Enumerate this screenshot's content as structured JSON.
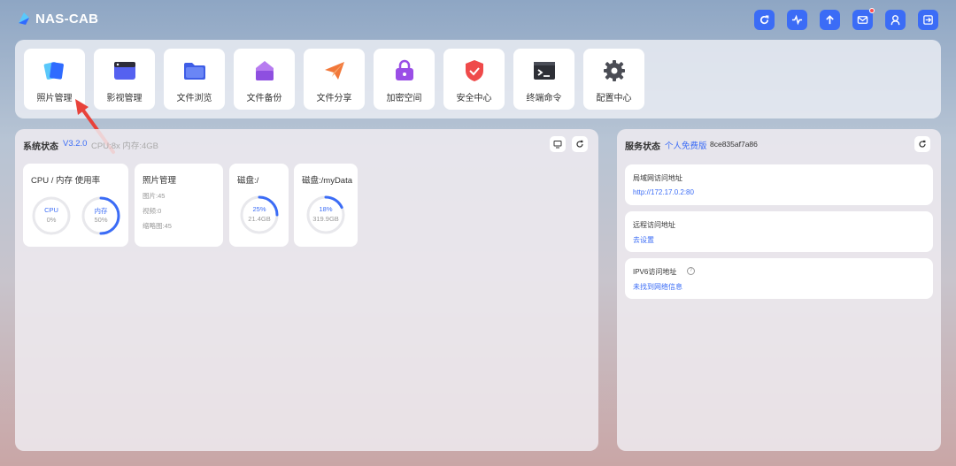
{
  "header": {
    "logo_text": "NAS-CAB"
  },
  "top_icons": [
    "refresh-icon",
    "pulse-icon",
    "upload-icon",
    "mail-icon",
    "user-icon",
    "logout-icon"
  ],
  "apps": [
    {
      "label": "照片管理",
      "icon": "photos-icon"
    },
    {
      "label": "影视管理",
      "icon": "video-icon"
    },
    {
      "label": "文件浏览",
      "icon": "folder-icon"
    },
    {
      "label": "文件备份",
      "icon": "backup-icon"
    },
    {
      "label": "文件分享",
      "icon": "share-icon"
    },
    {
      "label": "加密空间",
      "icon": "lock-icon"
    },
    {
      "label": "安全中心",
      "icon": "shield-icon"
    },
    {
      "label": "终端命令",
      "icon": "terminal-icon"
    },
    {
      "label": "配置中心",
      "icon": "gear-icon"
    }
  ],
  "system": {
    "title": "系统状态",
    "version": "V3.2.0",
    "sub": "CPU:8x 内存:4GB",
    "usage": {
      "title": "CPU / 内存 使用率",
      "cpu_label": "CPU",
      "cpu_value": "0%",
      "cpu_pct": 0,
      "mem_label": "内存",
      "mem_value": "50%",
      "mem_pct": 50
    },
    "photos": {
      "title": "照片管理",
      "line1": "图片:45",
      "line2": "视频:0",
      "line3": "缩略图:45"
    },
    "disk1": {
      "title": "磁盘:/",
      "pct_text": "25%",
      "pct": 25,
      "size": "21.4GB"
    },
    "disk2": {
      "title": "磁盘:/myData",
      "pct_text": "18%",
      "pct": 18,
      "size": "319.9GB"
    }
  },
  "service": {
    "title": "服务状态",
    "plan": "个人免费版",
    "id": "8ce835af7a86",
    "rows": [
      {
        "title": "局域网访问地址",
        "value": "http://172.17.0.2:80"
      },
      {
        "title": "远程访问地址",
        "value": "去设置"
      },
      {
        "title": "IPV6访问地址",
        "value": "未找到网络信息"
      }
    ]
  }
}
